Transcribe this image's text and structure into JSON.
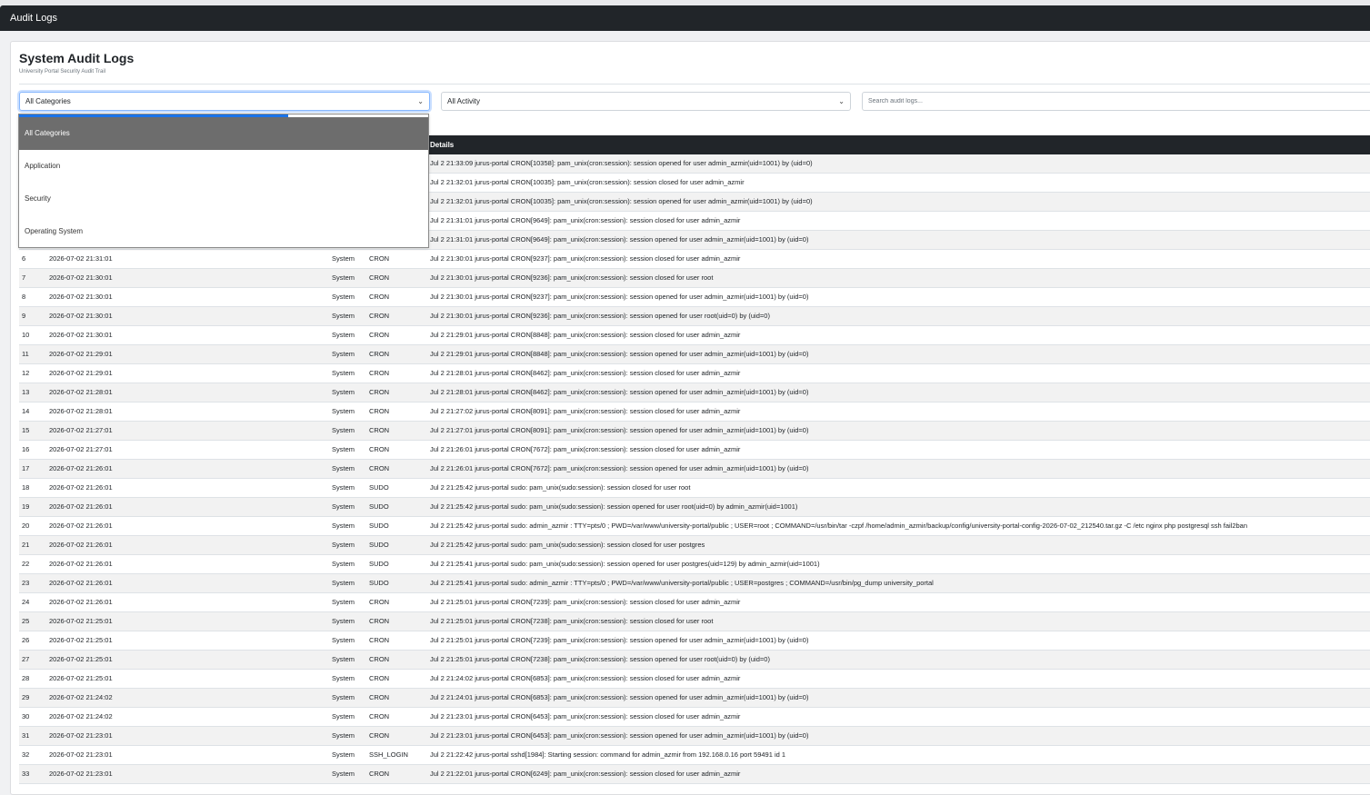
{
  "app": {
    "title": "Audit Logs"
  },
  "header": {
    "title": "System Audit Logs",
    "subtitle": "University Portal Security Audit Trail"
  },
  "filters": {
    "category": {
      "value": "All Categories",
      "options": [
        "All Categories",
        "Application",
        "Security",
        "Operating System"
      ]
    },
    "activity": {
      "value": "All Activity"
    },
    "search": {
      "placeholder": "Search audit logs..."
    }
  },
  "table": {
    "columns": {
      "details": "Details"
    },
    "rows": [
      {
        "num": "",
        "time": "",
        "category": "",
        "activity": "",
        "details": "Jul 2 21:33:09 jurus-portal CRON[10358]: pam_unix(cron:session): session opened for user admin_azmir(uid=1001) by (uid=0)"
      },
      {
        "num": "",
        "time": "",
        "category": "",
        "activity": "",
        "details": "Jul 2 21:32:01 jurus-portal CRON[10035]: pam_unix(cron:session): session closed for user admin_azmir"
      },
      {
        "num": "",
        "time": "",
        "category": "",
        "activity": "",
        "details": "Jul 2 21:32:01 jurus-portal CRON[10035]: pam_unix(cron:session): session opened for user admin_azmir(uid=1001) by (uid=0)"
      },
      {
        "num": "",
        "time": "",
        "category": "",
        "activity": "",
        "details": "Jul 2 21:31:01 jurus-portal CRON[9649]: pam_unix(cron:session): session closed for user admin_azmir"
      },
      {
        "num": "",
        "time": "",
        "category": "",
        "activity": "",
        "details": "Jul 2 21:31:01 jurus-portal CRON[9649]: pam_unix(cron:session): session opened for user admin_azmir(uid=1001) by (uid=0)"
      },
      {
        "num": "6",
        "time": "2026-07-02 21:31:01",
        "category": "System",
        "activity": "CRON",
        "details": "Jul 2 21:30:01 jurus-portal CRON[9237]: pam_unix(cron:session): session closed for user admin_azmir"
      },
      {
        "num": "7",
        "time": "2026-07-02 21:30:01",
        "category": "System",
        "activity": "CRON",
        "details": "Jul 2 21:30:01 jurus-portal CRON[9236]: pam_unix(cron:session): session closed for user root"
      },
      {
        "num": "8",
        "time": "2026-07-02 21:30:01",
        "category": "System",
        "activity": "CRON",
        "details": "Jul 2 21:30:01 jurus-portal CRON[9237]: pam_unix(cron:session): session opened for user admin_azmir(uid=1001) by (uid=0)"
      },
      {
        "num": "9",
        "time": "2026-07-02 21:30:01",
        "category": "System",
        "activity": "CRON",
        "details": "Jul 2 21:30:01 jurus-portal CRON[9236]: pam_unix(cron:session): session opened for user root(uid=0) by (uid=0)"
      },
      {
        "num": "10",
        "time": "2026-07-02 21:30:01",
        "category": "System",
        "activity": "CRON",
        "details": "Jul 2 21:29:01 jurus-portal CRON[8848]: pam_unix(cron:session): session closed for user admin_azmir"
      },
      {
        "num": "11",
        "time": "2026-07-02 21:29:01",
        "category": "System",
        "activity": "CRON",
        "details": "Jul 2 21:29:01 jurus-portal CRON[8848]: pam_unix(cron:session): session opened for user admin_azmir(uid=1001) by (uid=0)"
      },
      {
        "num": "12",
        "time": "2026-07-02 21:29:01",
        "category": "System",
        "activity": "CRON",
        "details": "Jul 2 21:28:01 jurus-portal CRON[8462]: pam_unix(cron:session): session closed for user admin_azmir"
      },
      {
        "num": "13",
        "time": "2026-07-02 21:28:01",
        "category": "System",
        "activity": "CRON",
        "details": "Jul 2 21:28:01 jurus-portal CRON[8462]: pam_unix(cron:session): session opened for user admin_azmir(uid=1001) by (uid=0)"
      },
      {
        "num": "14",
        "time": "2026-07-02 21:28:01",
        "category": "System",
        "activity": "CRON",
        "details": "Jul 2 21:27:02 jurus-portal CRON[8091]: pam_unix(cron:session): session closed for user admin_azmir"
      },
      {
        "num": "15",
        "time": "2026-07-02 21:27:01",
        "category": "System",
        "activity": "CRON",
        "details": "Jul 2 21:27:01 jurus-portal CRON[8091]: pam_unix(cron:session): session opened for user admin_azmir(uid=1001) by (uid=0)"
      },
      {
        "num": "16",
        "time": "2026-07-02 21:27:01",
        "category": "System",
        "activity": "CRON",
        "details": "Jul 2 21:26:01 jurus-portal CRON[7672]: pam_unix(cron:session): session closed for user admin_azmir"
      },
      {
        "num": "17",
        "time": "2026-07-02 21:26:01",
        "category": "System",
        "activity": "CRON",
        "details": "Jul 2 21:26:01 jurus-portal CRON[7672]: pam_unix(cron:session): session opened for user admin_azmir(uid=1001) by (uid=0)"
      },
      {
        "num": "18",
        "time": "2026-07-02 21:26:01",
        "category": "System",
        "activity": "SUDO",
        "details": "Jul 2 21:25:42 jurus-portal sudo: pam_unix(sudo:session): session closed for user root"
      },
      {
        "num": "19",
        "time": "2026-07-02 21:26:01",
        "category": "System",
        "activity": "SUDO",
        "details": "Jul 2 21:25:42 jurus-portal sudo: pam_unix(sudo:session): session opened for user root(uid=0) by admin_azmir(uid=1001)"
      },
      {
        "num": "20",
        "time": "2026-07-02 21:26:01",
        "category": "System",
        "activity": "SUDO",
        "details": "Jul 2 21:25:42 jurus-portal sudo: admin_azmir : TTY=pts/0 ; PWD=/var/www/university-portal/public ; USER=root ; COMMAND=/usr/bin/tar -czpf /home/admin_azmir/backup/config/university-portal-config-2026-07-02_212540.tar.gz -C /etc nginx php postgresql ssh fail2ban"
      },
      {
        "num": "21",
        "time": "2026-07-02 21:26:01",
        "category": "System",
        "activity": "SUDO",
        "details": "Jul 2 21:25:42 jurus-portal sudo: pam_unix(sudo:session): session closed for user postgres"
      },
      {
        "num": "22",
        "time": "2026-07-02 21:26:01",
        "category": "System",
        "activity": "SUDO",
        "details": "Jul 2 21:25:41 jurus-portal sudo: pam_unix(sudo:session): session opened for user postgres(uid=129) by admin_azmir(uid=1001)"
      },
      {
        "num": "23",
        "time": "2026-07-02 21:26:01",
        "category": "System",
        "activity": "SUDO",
        "details": "Jul 2 21:25:41 jurus-portal sudo: admin_azmir : TTY=pts/0 ; PWD=/var/www/university-portal/public ; USER=postgres ; COMMAND=/usr/bin/pg_dump university_portal"
      },
      {
        "num": "24",
        "time": "2026-07-02 21:26:01",
        "category": "System",
        "activity": "CRON",
        "details": "Jul 2 21:25:01 jurus-portal CRON[7239]: pam_unix(cron:session): session closed for user admin_azmir"
      },
      {
        "num": "25",
        "time": "2026-07-02 21:25:01",
        "category": "System",
        "activity": "CRON",
        "details": "Jul 2 21:25:01 jurus-portal CRON[7238]: pam_unix(cron:session): session closed for user root"
      },
      {
        "num": "26",
        "time": "2026-07-02 21:25:01",
        "category": "System",
        "activity": "CRON",
        "details": "Jul 2 21:25:01 jurus-portal CRON[7239]: pam_unix(cron:session): session opened for user admin_azmir(uid=1001) by (uid=0)"
      },
      {
        "num": "27",
        "time": "2026-07-02 21:25:01",
        "category": "System",
        "activity": "CRON",
        "details": "Jul 2 21:25:01 jurus-portal CRON[7238]: pam_unix(cron:session): session opened for user root(uid=0) by (uid=0)"
      },
      {
        "num": "28",
        "time": "2026-07-02 21:25:01",
        "category": "System",
        "activity": "CRON",
        "details": "Jul 2 21:24:02 jurus-portal CRON[6853]: pam_unix(cron:session): session closed for user admin_azmir"
      },
      {
        "num": "29",
        "time": "2026-07-02 21:24:02",
        "category": "System",
        "activity": "CRON",
        "details": "Jul 2 21:24:01 jurus-portal CRON[6853]: pam_unix(cron:session): session opened for user admin_azmir(uid=1001) by (uid=0)"
      },
      {
        "num": "30",
        "time": "2026-07-02 21:24:02",
        "category": "System",
        "activity": "CRON",
        "details": "Jul 2 21:23:01 jurus-portal CRON[6453]: pam_unix(cron:session): session closed for user admin_azmir"
      },
      {
        "num": "31",
        "time": "2026-07-02 21:23:01",
        "category": "System",
        "activity": "CRON",
        "details": "Jul 2 21:23:01 jurus-portal CRON[6453]: pam_unix(cron:session): session opened for user admin_azmir(uid=1001) by (uid=0)"
      },
      {
        "num": "32",
        "time": "2026-07-02 21:23:01",
        "category": "System",
        "activity": "SSH_LOGIN",
        "details": "Jul 2 21:22:42 jurus-portal sshd[1984]: Starting session: command for admin_azmir from 192.168.0.16 port 59491 id 1"
      },
      {
        "num": "33",
        "time": "2026-07-02 21:23:01",
        "category": "System",
        "activity": "CRON",
        "details": "Jul 2 21:22:01 jurus-portal CRON[6249]: pam_unix(cron:session): session closed for user admin_azmir"
      }
    ]
  },
  "icons": {
    "select_chevron": "chevron-down-icon"
  },
  "colors": {
    "header_bg": "#212529",
    "focus": "#86b7fe",
    "dropdown_selected": "#6d6d6d"
  }
}
